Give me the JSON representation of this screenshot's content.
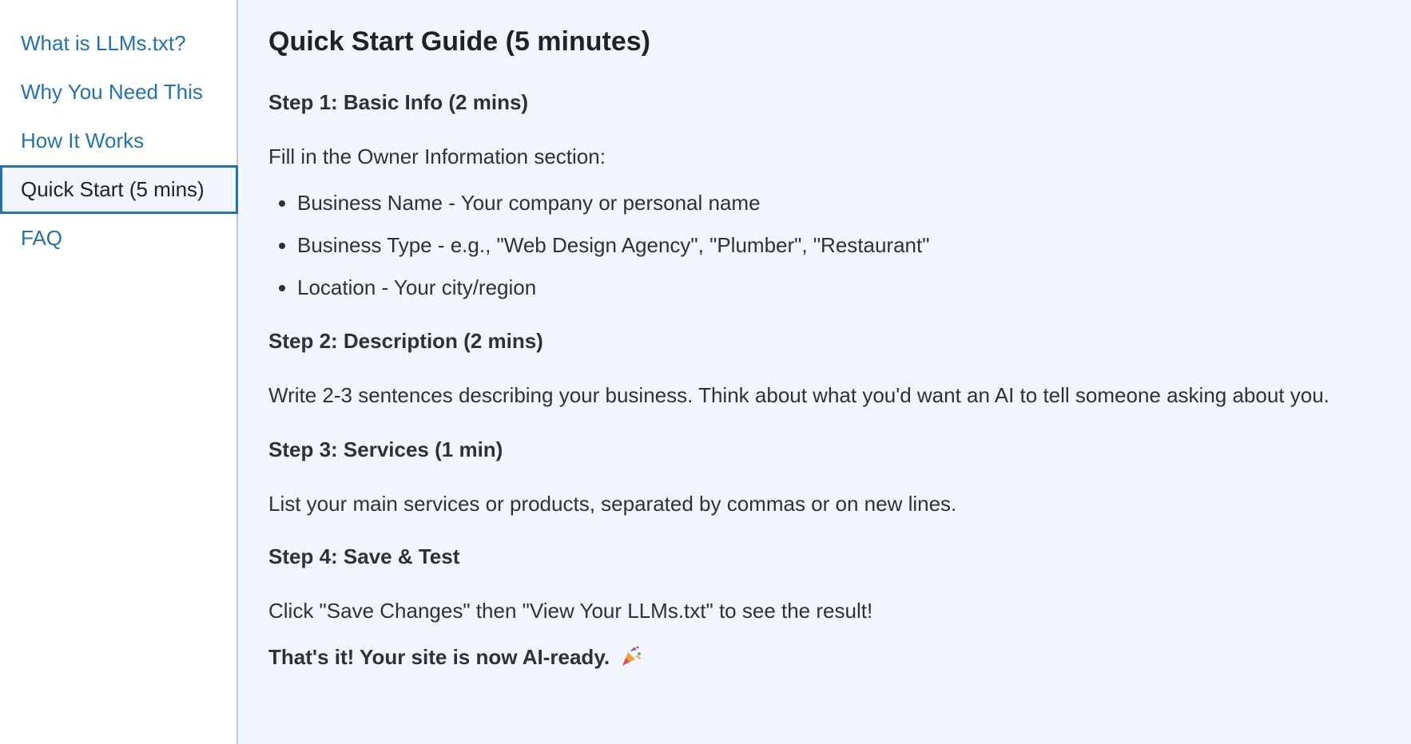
{
  "sidebar": {
    "items": [
      {
        "label": "What is LLMs.txt?"
      },
      {
        "label": "Why You Need This"
      },
      {
        "label": "How It Works"
      },
      {
        "label": "Quick Start (5 mins)"
      },
      {
        "label": "FAQ"
      }
    ],
    "active_index": 3
  },
  "main": {
    "title": "Quick Start Guide (5 minutes)",
    "step1": {
      "heading": "Step 1: Basic Info (2 mins)",
      "intro": "Fill in the Owner Information section:",
      "bullets": [
        "Business Name - Your company or personal name",
        "Business Type - e.g., \"Web Design Agency\", \"Plumber\", \"Restaurant\"",
        "Location - Your city/region"
      ]
    },
    "step2": {
      "heading": "Step 2: Description (2 mins)",
      "text": "Write 2-3 sentences describing your business. Think about what you'd want an AI to tell someone asking about you."
    },
    "step3": {
      "heading": "Step 3: Services (1 min)",
      "text": "List your main services or products, separated by commas or on new lines."
    },
    "step4": {
      "heading": "Step 4: Save & Test",
      "text": "Click \"Save Changes\" then \"View Your LLMs.txt\" to see the result!"
    },
    "final": "That's it! Your site is now AI-ready.",
    "final_icon": "party-popper-icon"
  },
  "colors": {
    "link": "#2271b1",
    "background": "#f0f6fc",
    "sidebar_bg": "#ffffff",
    "text": "#2c3338"
  }
}
